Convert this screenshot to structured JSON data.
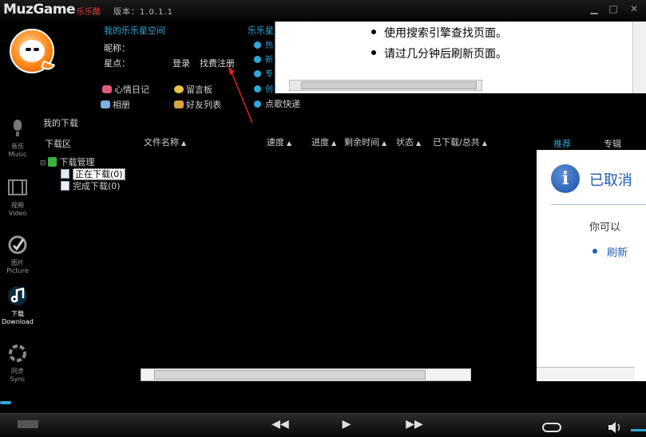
{
  "app": {
    "brand": "MuzGame",
    "brand_cn": "乐乐酷",
    "version": "版本：1.0.1.1"
  },
  "user": {
    "myspace_title": "我的乐乐星空间",
    "nickname_label": "昵称：",
    "stars_label": "星点：",
    "login_link": "登录",
    "register_link": "找费注册"
  },
  "features": {
    "diary": "心情日记",
    "guestbook": "留言板",
    "album": "相册",
    "friends": "好友列表"
  },
  "music_list": {
    "title": "乐乐星",
    "rows": [
      "热",
      "新",
      "专",
      "创"
    ],
    "request_song": "点歌快递"
  },
  "browser_error": {
    "line1": "使用搜索引擎查找页面。",
    "line2": "请过几分钟后刷新页面。"
  },
  "nav": [
    {
      "label_cn": "音乐",
      "label_en": "Music",
      "icon": "microphone-icon"
    },
    {
      "label_cn": "视频",
      "label_en": "Video",
      "icon": "film-icon"
    },
    {
      "label_cn": "图片",
      "label_en": "Picture",
      "icon": "picture-icon"
    },
    {
      "label_cn": "下载",
      "label_en": "Download",
      "icon": "music-note-icon"
    },
    {
      "label_cn": "同步",
      "label_en": "Sync",
      "icon": "sync-icon"
    }
  ],
  "download": {
    "section_title": "我的下载",
    "zone_title": "下载区",
    "columns": [
      "文件名称",
      "速度",
      "进度",
      "剩余时间",
      "状态",
      "已下载/总共"
    ],
    "tree": {
      "root": "下载管理",
      "downloading": "正在下载(0)",
      "completed": "完成下载(0)"
    }
  },
  "right_panel": {
    "tab_recommend": "推荐",
    "tab_album": "专辑",
    "cancel_text": "已取消",
    "can_text": "你可以",
    "refresh_text": "刷新"
  },
  "player": {
    "prev_icon": "previous-icon",
    "play_icon": "play-icon",
    "next_icon": "next-icon",
    "repeat_icon": "repeat-icon",
    "volume_icon": "volume-icon"
  },
  "colors": {
    "accent": "#2fa9d8",
    "link_blue": "#1f5bb5",
    "alert_red": "#e04040"
  }
}
